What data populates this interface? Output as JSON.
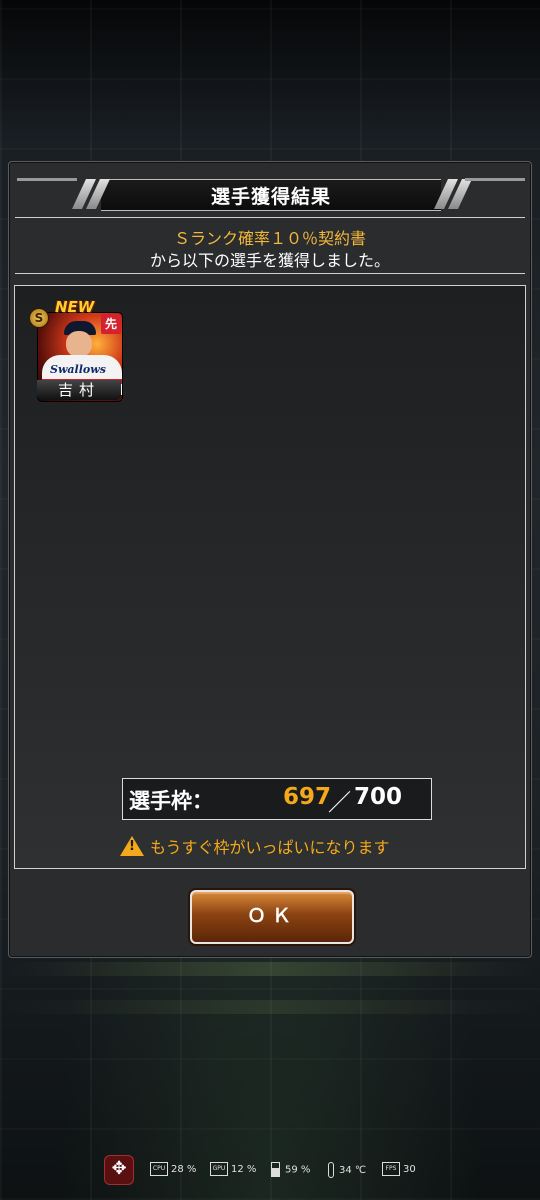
{
  "dialog": {
    "title": "選手獲得結果",
    "contract_name": "Ｓランク確率１０％契約書",
    "message": "から以下の選手を獲得しました。"
  },
  "player_card": {
    "badge": "NEW",
    "rank": "S",
    "position": "先",
    "team_logo": "Swallows",
    "name": "吉村"
  },
  "roster": {
    "label": "選手枠：",
    "current": "697",
    "separator": "／",
    "max": "700"
  },
  "warning": {
    "icon": "warning-icon",
    "text": "もうすぐ枠がいっぱいになります"
  },
  "ok_button": {
    "label": "ＯＫ"
  },
  "status_bar": {
    "cpu": "28 %",
    "gpu": "12 %",
    "battery": "59 %",
    "temperature": "34 ℃",
    "fps": "30"
  },
  "colors": {
    "accent_orange": "#f2b73b",
    "panel_bg": "#2a2c2e",
    "button_brown": "#8b4212"
  }
}
